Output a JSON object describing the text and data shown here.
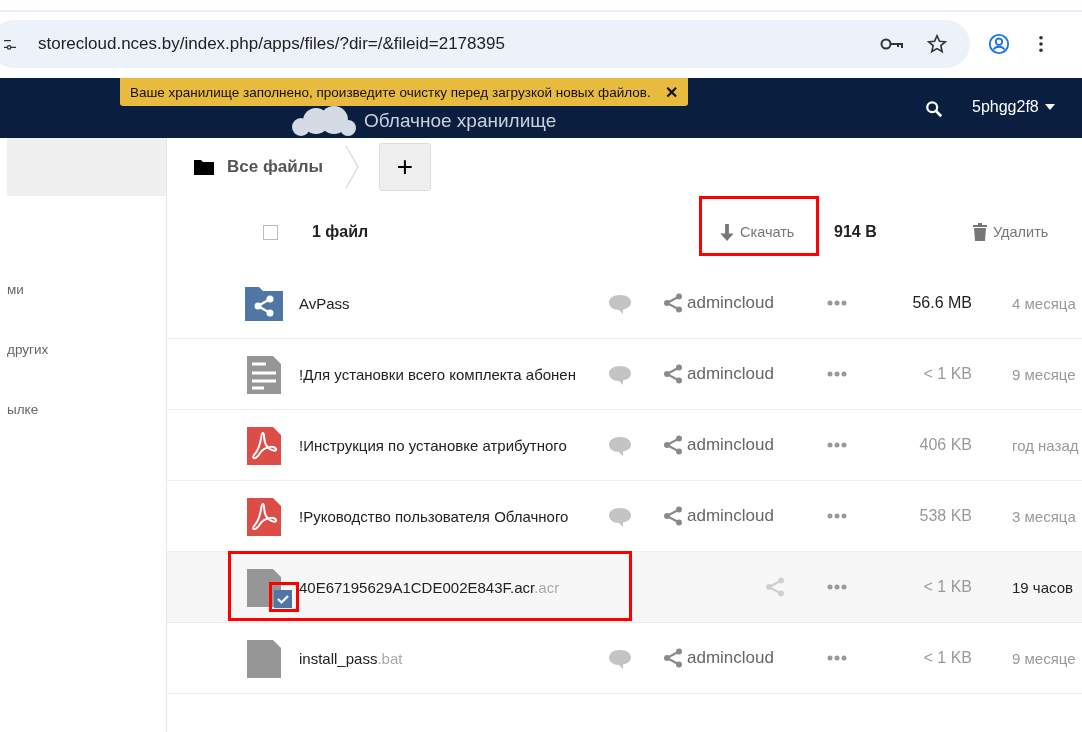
{
  "browser": {
    "url": "storecloud.nces.by/index.php/apps/files/?dir=/&fileid=2178395"
  },
  "header": {
    "app_title": "Облачное хранилище",
    "user": "5phgg2f8"
  },
  "notification": {
    "text": "Ваше хранилище заполнено, произведите очистку перед загрузкой новых файлов.",
    "close": "✕"
  },
  "sidebar": {
    "items": [
      {
        "label": "ми"
      },
      {
        "label": "других"
      },
      {
        "label": "ылке"
      }
    ]
  },
  "breadcrumb": {
    "label": "Все файлы",
    "add": "+"
  },
  "selection_bar": {
    "checked": false,
    "count": "1 файл",
    "download": "Скачать",
    "size": "914 B",
    "delete": "Удалить"
  },
  "files": [
    {
      "kind": "shared-folder",
      "name": "AvPass",
      "comment": true,
      "owner": "admincloud",
      "size": "56.6 MB",
      "size_strong": true,
      "date": "4 месяца",
      "selected": false
    },
    {
      "kind": "text",
      "name": "!Для установки всего комплекта абонен",
      "comment": true,
      "owner": "admincloud",
      "size": "< 1 KB",
      "size_strong": false,
      "date": "9 месяце",
      "selected": false
    },
    {
      "kind": "pdf",
      "name": "!Инструкция по установке атрибутного",
      "comment": true,
      "owner": "admincloud",
      "size": "406 KB",
      "size_strong": false,
      "date": "год назад",
      "selected": false
    },
    {
      "kind": "pdf",
      "name": "!Руководство пользователя Облачного",
      "comment": true,
      "owner": "admincloud",
      "size": "538 KB",
      "size_strong": false,
      "date": "3 месяца",
      "selected": false
    },
    {
      "kind": "file",
      "name": "40E67195629A1CDE002E843F.acr",
      "ext": ".acr",
      "comment": false,
      "size": "< 1 KB",
      "size_strong": false,
      "date": "19 часов",
      "selected": true
    },
    {
      "kind": "file",
      "name": "install_pass",
      "ext": ".bat",
      "comment": true,
      "owner": "admincloud",
      "size": "< 1 KB",
      "size_strong": false,
      "date": "9 месяце",
      "selected": false
    }
  ]
}
